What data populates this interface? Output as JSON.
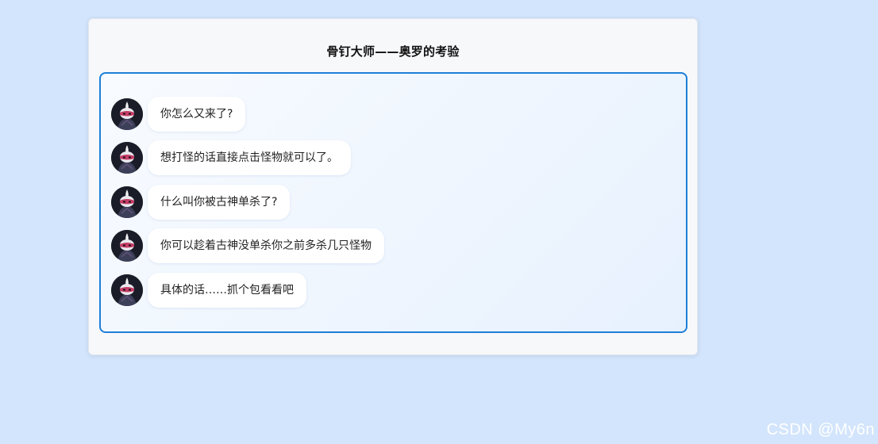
{
  "page": {
    "title": "骨钉大师——奥罗的考验",
    "watermark": "CSDN @My6n"
  },
  "chat": {
    "messages": [
      {
        "text": "你怎么又来了?",
        "avatar": "hollow-knight-avatar-icon"
      },
      {
        "text": "想打怪的话直接点击怪物就可以了。",
        "avatar": "hollow-knight-avatar-icon"
      },
      {
        "text": "什么叫你被古神单杀了?",
        "avatar": "hollow-knight-avatar-icon"
      },
      {
        "text": "你可以趁着古神没单杀你之前多杀几只怪物",
        "avatar": "hollow-knight-avatar-icon"
      },
      {
        "text": "具体的话……抓个包看看吧",
        "avatar": "hollow-knight-avatar-icon"
      }
    ]
  },
  "colors": {
    "background": "#d3e5fc",
    "chat_border": "#1d7fd8",
    "bubble": "#ffffff"
  }
}
